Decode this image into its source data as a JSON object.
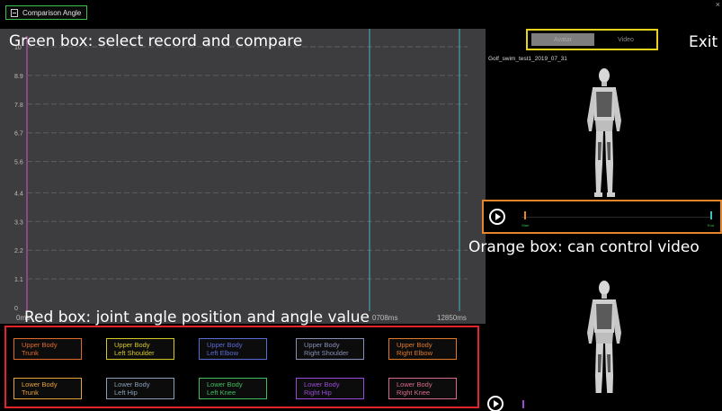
{
  "window": {
    "title": "Comparison Angle"
  },
  "chart_data": {
    "type": "line",
    "y_ticks": [
      "10",
      "8.9",
      "7.8",
      "6.7",
      "5.6",
      "4.4",
      "3.3",
      "2.2",
      "1.1",
      "0"
    ],
    "x_tick_labels": {
      "start": "0ms",
      "mid": "0708ms",
      "end": "12850ms"
    },
    "ylim": [
      0,
      10
    ],
    "grid": true,
    "series": []
  },
  "joint_buttons": [
    {
      "group": "Upper Body",
      "part": "Trunk",
      "color": "#e06a2a"
    },
    {
      "group": "Upper Body",
      "part": "Left Shoulder",
      "color": "#d7c82a"
    },
    {
      "group": "Upper Body",
      "part": "Left Elbow",
      "color": "#5a6bd6"
    },
    {
      "group": "Upper Body",
      "part": "Right Shoulder",
      "color": "#8a8fb8"
    },
    {
      "group": "Upper Body",
      "part": "Right Elbow",
      "color": "#e07a2a"
    },
    {
      "group": "Lower Body",
      "part": "Trunk",
      "color": "#e8a23a"
    },
    {
      "group": "Lower Body",
      "part": "Left Hip",
      "color": "#8aa0b8"
    },
    {
      "group": "Lower Body",
      "part": "Left Knee",
      "color": "#3fbf5f"
    },
    {
      "group": "Lower Body",
      "part": "Right Hip",
      "color": "#9a4ad6"
    },
    {
      "group": "Lower Body",
      "part": "Right Knee",
      "color": "#d66a8a"
    }
  ],
  "view_toggle": {
    "avatar_label": "Avatar",
    "video_label": "Video"
  },
  "record": {
    "name": "Golf_swim_test1_2019_07_31"
  },
  "player": {
    "start_label": "Start",
    "end_label": "End"
  },
  "annotations": {
    "green": "Green box: select record and compare",
    "exit": "Exit",
    "orange": "Orange box: can control video",
    "red": "Red box: joint angle position and angle value"
  }
}
